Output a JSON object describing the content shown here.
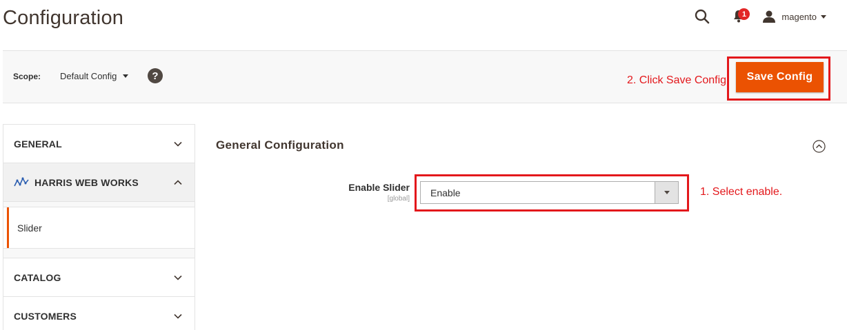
{
  "page": {
    "title": "Configuration"
  },
  "header": {
    "notifications_count": "1",
    "user_name": "magento"
  },
  "actions_bar": {
    "scope_label": "Scope:",
    "scope_value": "Default Config",
    "help_symbol": "?",
    "save_label": "Save Config"
  },
  "annotations": {
    "save_step": "2. Click Save Config",
    "select_step": "1. Select enable."
  },
  "sidebar": {
    "tabs": [
      {
        "label": "GENERAL",
        "expanded": false
      },
      {
        "label": "HARRIS WEB WORKS",
        "expanded": true,
        "items": [
          {
            "label": "Slider",
            "active": true
          }
        ]
      },
      {
        "label": "CATALOG",
        "expanded": false
      },
      {
        "label": "CUSTOMERS",
        "expanded": false
      }
    ]
  },
  "section": {
    "title": "General Configuration",
    "field": {
      "label": "Enable Slider",
      "scope": "[global]",
      "value": "Enable"
    }
  },
  "colors": {
    "accent": "#eb5202",
    "annotation": "#e3171b",
    "badge": "#e22626"
  },
  "icons": [
    "search-icon",
    "bell-icon",
    "user-icon",
    "help-icon",
    "chevron-down-icon",
    "chevron-up-icon",
    "harris-logo-icon",
    "collapse-circle-icon"
  ]
}
